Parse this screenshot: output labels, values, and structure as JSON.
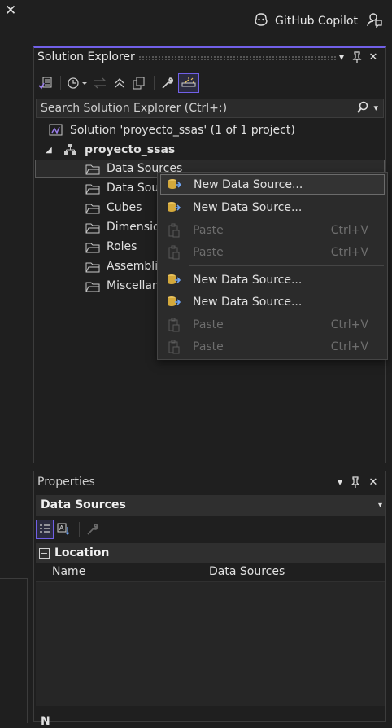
{
  "topbar": {
    "copilot_label": "GitHub Copilot"
  },
  "solution_explorer": {
    "title": "Solution Explorer",
    "search_placeholder": "Search Solution Explorer (Ctrl+;)",
    "tree": {
      "solution": "Solution 'proyecto_ssas' (1 of 1 project)",
      "project": "proyecto_ssas",
      "items": [
        "Data Sources",
        "Data Sou",
        "Cubes",
        "Dimensio",
        "Roles",
        "Assemblie",
        "Miscellan"
      ]
    }
  },
  "context_menu": {
    "items": [
      {
        "label": "New Data Source...",
        "shortcut": ""
      },
      {
        "label": "New Data Source...",
        "shortcut": ""
      },
      {
        "label": "Paste",
        "shortcut": "Ctrl+V"
      },
      {
        "label": "Paste",
        "shortcut": "Ctrl+V"
      },
      {
        "label": "New Data Source...",
        "shortcut": ""
      },
      {
        "label": "New Data Source...",
        "shortcut": ""
      },
      {
        "label": "Paste",
        "shortcut": "Ctrl+V"
      },
      {
        "label": "Paste",
        "shortcut": "Ctrl+V"
      }
    ]
  },
  "properties": {
    "title": "Properties",
    "object": "Data Sources",
    "category": "Location",
    "rows": [
      {
        "name": "Name",
        "value": "Data Sources"
      }
    ]
  },
  "bottom": {
    "label": "N"
  },
  "colors": {
    "accent": "#7160e8",
    "background": "#1f1f1f",
    "menu": "#2b2b2b"
  }
}
